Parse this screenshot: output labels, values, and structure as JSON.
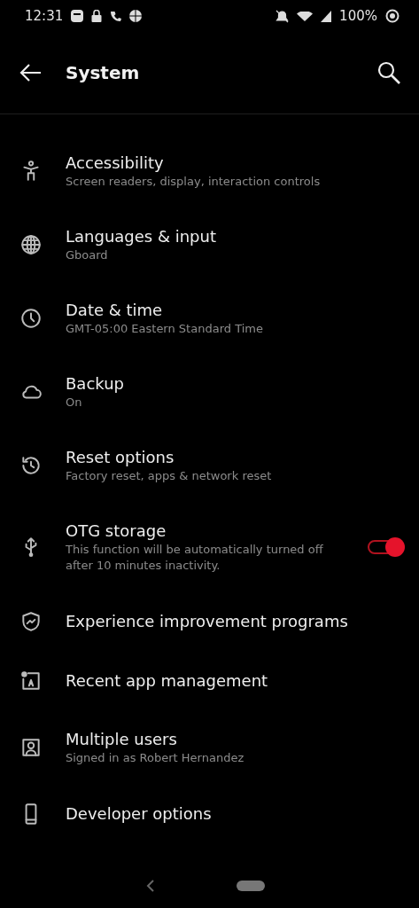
{
  "status_bar": {
    "time": "12:31",
    "battery": "100%"
  },
  "header": {
    "title": "System"
  },
  "items": [
    {
      "title": "Accessibility",
      "subtitle": "Screen readers, display, interaction controls"
    },
    {
      "title": "Languages & input",
      "subtitle": "Gboard"
    },
    {
      "title": "Date & time",
      "subtitle": "GMT-05:00 Eastern Standard Time"
    },
    {
      "title": "Backup",
      "subtitle": "On"
    },
    {
      "title": "Reset options",
      "subtitle": "Factory reset, apps & network reset"
    },
    {
      "title": "OTG storage",
      "subtitle": "This function will be automatically turned off after 10 minutes inactivity.",
      "toggle": {
        "on": true
      }
    },
    {
      "title": "Experience improvement programs"
    },
    {
      "title": "Recent app management"
    },
    {
      "title": "Multiple users",
      "subtitle": "Signed in as Robert Hernandez"
    },
    {
      "title": "Developer options"
    }
  ]
}
